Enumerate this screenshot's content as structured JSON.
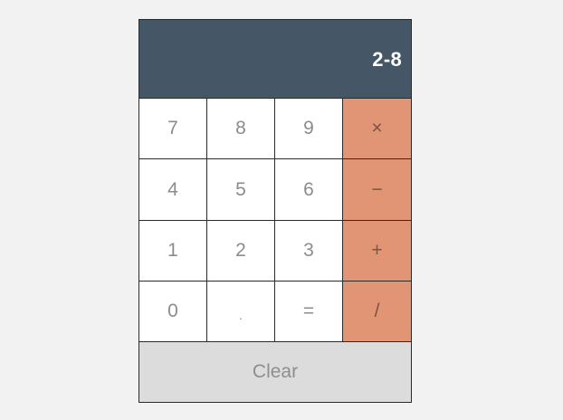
{
  "calculator": {
    "display": "2-8",
    "keys": {
      "row1": [
        "7",
        "8",
        "9",
        "×"
      ],
      "row2": [
        "4",
        "5",
        "6",
        "−"
      ],
      "row3": [
        "1",
        "2",
        "3",
        "+"
      ],
      "row4": [
        "0",
        ".",
        "=",
        "/"
      ]
    },
    "clear_label": "Clear"
  },
  "colors": {
    "background": "#f2f2f2",
    "display_bg": "#455766",
    "display_text": "#ffffff",
    "operator_bg": "#e29575",
    "clear_bg": "#dcdcdc",
    "border": "#2b2b2b"
  }
}
